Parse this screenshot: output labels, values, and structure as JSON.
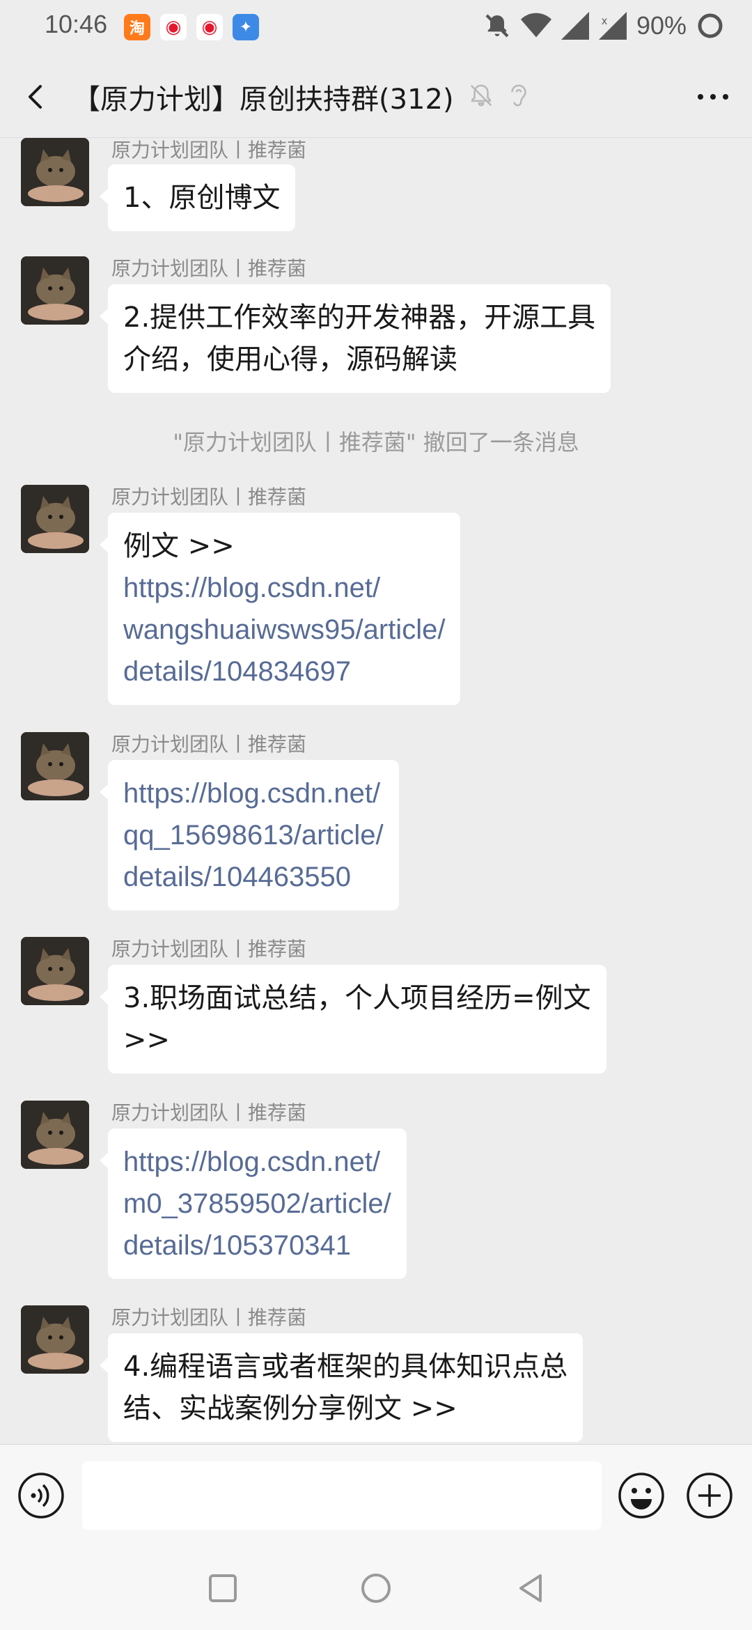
{
  "status_bar": {
    "time": "10:46",
    "battery": "90%",
    "app_icons": [
      "taobao-icon",
      "weibo-icon",
      "weibo-icon",
      "app-bird-icon"
    ],
    "right_icons": [
      "mute-bell-icon",
      "wifi-icon",
      "signal-icon",
      "signal-icon",
      "battery-icon"
    ]
  },
  "header": {
    "title": "【原力计划】原创扶持群(312)",
    "icons": [
      "mute-bell-icon",
      "ear-icon"
    ]
  },
  "messages": [
    {
      "sender": "原力计划团队丨推荐菌",
      "lines": [
        {
          "text": "1、原创博文",
          "link": false
        }
      ]
    },
    {
      "sender": "原力计划团队丨推荐菌",
      "lines": [
        {
          "text": "2.提供工作效率的开发神器，开源工具",
          "link": false
        },
        {
          "text": "介绍，使用心得，源码解读",
          "link": false
        }
      ]
    },
    {
      "system": "\"原力计划团队丨推荐菌\" 撤回了一条消息"
    },
    {
      "sender": "原力计划团队丨推荐菌",
      "lines": [
        {
          "text": "例文 >>",
          "link": false
        },
        {
          "text": "https://blog.csdn.net/",
          "link": true
        },
        {
          "text": "wangshuaiwsws95/article/",
          "link": true
        },
        {
          "text": "details/104834697",
          "link": true
        }
      ]
    },
    {
      "sender": "原力计划团队丨推荐菌",
      "lines": [
        {
          "text": "https://blog.csdn.net/",
          "link": true
        },
        {
          "text": "qq_15698613/article/",
          "link": true
        },
        {
          "text": "details/104463550",
          "link": true
        }
      ]
    },
    {
      "sender": "原力计划团队丨推荐菌",
      "lines": [
        {
          "text": "3.职场面试总结，个人项目经历=例文",
          "link": false
        },
        {
          "text": ">>",
          "link": false
        }
      ]
    },
    {
      "sender": "原力计划团队丨推荐菌",
      "lines": [
        {
          "text": "https://blog.csdn.net/",
          "link": true
        },
        {
          "text": "m0_37859502/article/",
          "link": true
        },
        {
          "text": "details/105370341",
          "link": true
        }
      ]
    },
    {
      "sender": "原力计划团队丨推荐菌",
      "lines": [
        {
          "text": "4.编程语言或者框架的具体知识点总",
          "link": false
        },
        {
          "text": "结、实战案例分享例文 >>",
          "link": false
        }
      ]
    }
  ],
  "input_bar": {
    "placeholder": "",
    "icons": [
      "voice-icon",
      "emoji-icon",
      "plus-icon"
    ]
  },
  "colors": {
    "background": "#ededed",
    "bubble": "#ffffff",
    "link": "#576b95",
    "sender": "#8a8a8a",
    "system": "#9a9a9a"
  }
}
